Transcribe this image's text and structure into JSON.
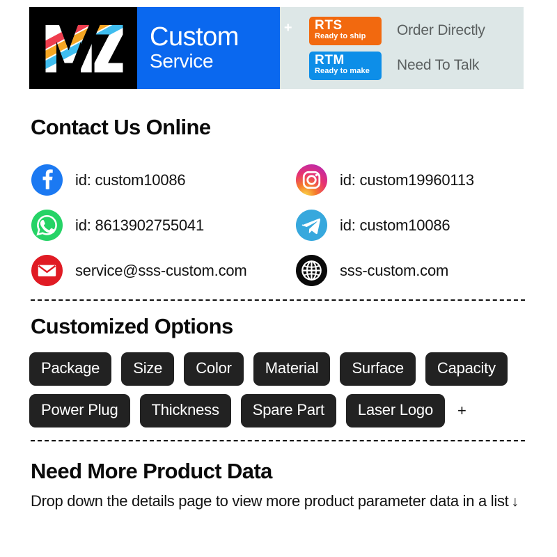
{
  "banner": {
    "logo_alt": "MZ",
    "brand_name": "Custom",
    "brand_plus": "+",
    "brand_sub": "Service",
    "badges": [
      {
        "abbr": "RTS",
        "full": "Ready to ship",
        "caption": "Order Directly",
        "color": "#f2690f"
      },
      {
        "abbr": "RTM",
        "full": "Ready to make",
        "caption": "Need To Talk",
        "color": "#0d8ee8"
      }
    ]
  },
  "contact": {
    "title": "Contact Us Online",
    "items": [
      {
        "icon": "facebook-icon",
        "text": "id: custom10086"
      },
      {
        "icon": "instagram-icon",
        "text": "id: custom19960113"
      },
      {
        "icon": "whatsapp-icon",
        "text": "id: 8613902755041"
      },
      {
        "icon": "telegram-icon",
        "text": "id: custom10086"
      },
      {
        "icon": "email-icon",
        "text": "service@sss-custom.com"
      },
      {
        "icon": "globe-icon",
        "text": "sss-custom.com"
      }
    ]
  },
  "options": {
    "title": "Customized Options",
    "tags": [
      "Package",
      "Size",
      "Color",
      "Material",
      "Surface",
      "Capacity",
      "Power Plug",
      "Thickness",
      "Spare Part",
      "Laser Logo"
    ],
    "more_symbol": "+"
  },
  "more_data": {
    "title": "Need More Product Data",
    "description": "Drop down the details page to view more product parameter data in a list",
    "arrow": "↓"
  },
  "colors": {
    "banner_black": "#000000",
    "banner_blue": "#0a68ef",
    "banner_pale": "#dde7e7",
    "chip_dark": "#222222",
    "caption_grey": "#5b6060"
  }
}
